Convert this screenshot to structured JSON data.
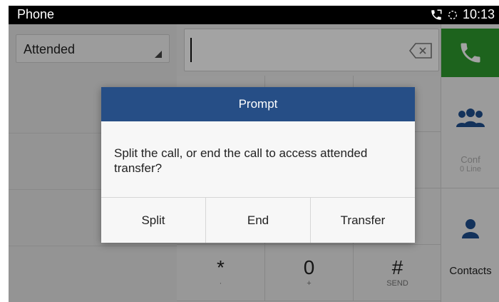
{
  "statusbar": {
    "app_title": "Phone",
    "time": "10:13",
    "icons": [
      "phone-status-icon",
      "sync-icon"
    ]
  },
  "dialer": {
    "transfer_mode": "Attended",
    "number_value": "",
    "keypad_visible_keys": [
      {
        "digit": "*",
        "sub": "·"
      },
      {
        "digit": "0",
        "sub": "+"
      },
      {
        "digit": "#",
        "sub": "SEND"
      }
    ]
  },
  "sidebar": {
    "conf_label": "Conf",
    "conf_sub": "0 Line",
    "contacts_label": "Contacts"
  },
  "dialog": {
    "title": "Prompt",
    "message": "Split the call, or end the call to access attended transfer?",
    "buttons": {
      "split": "Split",
      "end": "End",
      "transfer": "Transfer"
    }
  },
  "colors": {
    "statusbar_bg": "#000000",
    "dialog_header": "#264e86",
    "call_button": "#2e9b2e",
    "icon_blue": "#1f4f8f"
  }
}
